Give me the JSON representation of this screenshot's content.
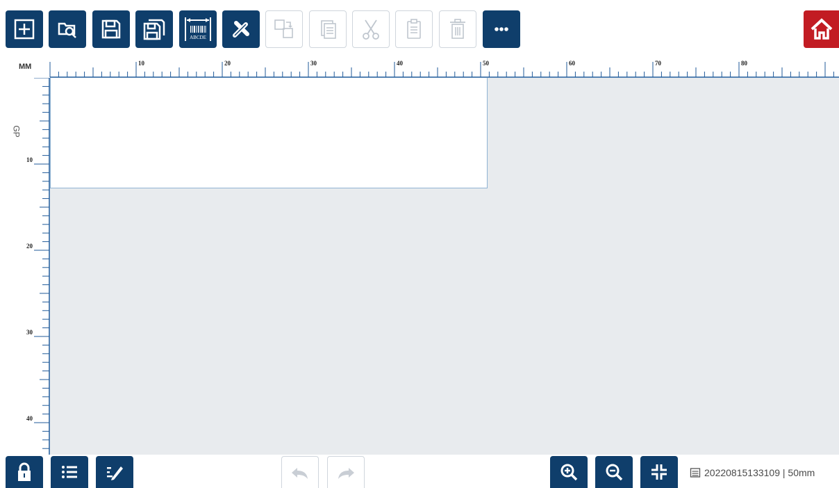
{
  "toolbar": {
    "buttons": [
      {
        "name": "new-icon",
        "state": "active"
      },
      {
        "name": "open-file-icon",
        "state": "active"
      },
      {
        "name": "save-icon",
        "state": "active"
      },
      {
        "name": "save-as-icon",
        "state": "active"
      },
      {
        "name": "barcode-size-icon",
        "state": "active",
        "caption": "ABCDE"
      },
      {
        "name": "tools-icon",
        "state": "active"
      },
      {
        "name": "arrange-icon",
        "state": "disabled"
      },
      {
        "name": "copy-icon",
        "state": "disabled"
      },
      {
        "name": "cut-icon",
        "state": "disabled"
      },
      {
        "name": "paste-icon",
        "state": "disabled"
      },
      {
        "name": "delete-icon",
        "state": "disabled"
      },
      {
        "name": "more-icon",
        "state": "active"
      }
    ],
    "home": {
      "name": "home-icon"
    }
  },
  "ruler": {
    "unit": "MM",
    "side_label": "GP",
    "top_labels": [
      "10",
      "20",
      "30",
      "40",
      "50",
      "60",
      "70",
      "80"
    ],
    "left_labels": [
      "10",
      "20",
      "30",
      "40"
    ]
  },
  "bottom": {
    "left_buttons": [
      {
        "name": "lock-icon",
        "state": "active"
      },
      {
        "name": "list-icon",
        "state": "active"
      },
      {
        "name": "edit-icon",
        "state": "active"
      }
    ],
    "history_buttons": [
      {
        "name": "undo-icon",
        "state": "disabled"
      },
      {
        "name": "redo-icon",
        "state": "disabled"
      }
    ],
    "zoom_buttons": [
      {
        "name": "zoom-in-icon",
        "state": "active"
      },
      {
        "name": "zoom-out-icon",
        "state": "active"
      },
      {
        "name": "fit-to-screen-icon",
        "state": "active"
      }
    ],
    "status_text": "20220815133109 | 50mm"
  },
  "colors": {
    "accent": "#0f3e6b",
    "home": "#c21c23",
    "ruler": "#1f5a9a",
    "workspace": "#e8ebee"
  }
}
